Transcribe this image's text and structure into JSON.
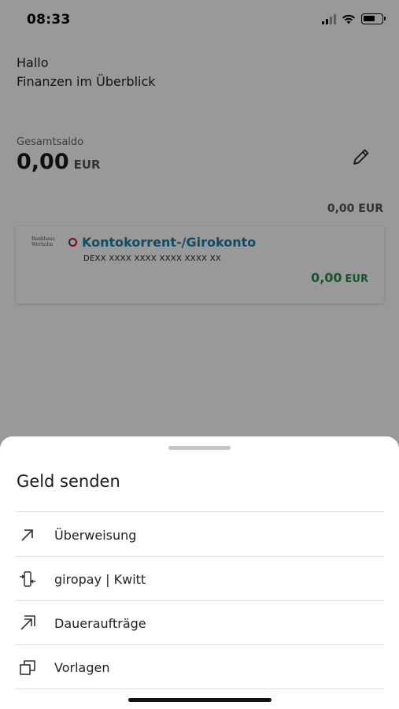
{
  "status_bar": {
    "time": "08:33"
  },
  "header": {
    "greeting": "Hallo",
    "subtitle": "Finanzen im Überblick"
  },
  "total": {
    "label": "Gesamtsaldo",
    "amount": "0,00",
    "currency": "EUR"
  },
  "account_group_total": "0,00 EUR",
  "account": {
    "bank_logo": "Bankhaus Werhahn",
    "name": "Kontokorrent-/Girokonto",
    "iban": "DEXX XXXX XXXX XXXX XXXX XX",
    "balance_amount": "0,00",
    "balance_currency": "EUR",
    "balance_color": "#2d8a4e",
    "name_color": "#1e7ea8"
  },
  "sheet": {
    "title": "Geld senden",
    "items": [
      {
        "label": "Überweisung",
        "icon": "arrow-up-right-icon"
      },
      {
        "label": "giropay | Kwitt",
        "icon": "phone-transfer-icon"
      },
      {
        "label": "Daueraufträge",
        "icon": "recurring-transfer-icon"
      },
      {
        "label": "Vorlagen",
        "icon": "templates-icon"
      }
    ]
  }
}
